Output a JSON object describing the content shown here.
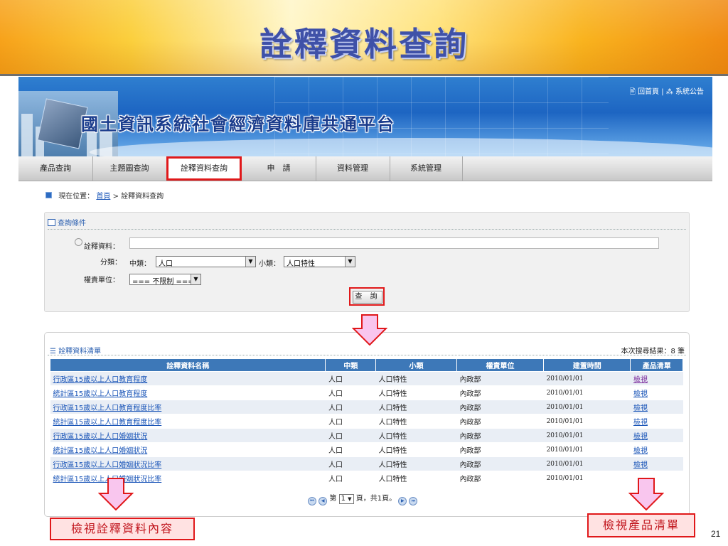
{
  "slide": {
    "title": "詮釋資料查詢",
    "page_number": "21"
  },
  "banner": {
    "site_name": "國土資訊系統社會經濟資料庫共通平台",
    "home_link": "回首頁",
    "separator": "|",
    "announce_link": "系統公告"
  },
  "nav": {
    "items": [
      {
        "label": "產品查詢"
      },
      {
        "label": "主題圖查詢"
      },
      {
        "label": "詮釋資料查詢"
      },
      {
        "label": "申　請"
      },
      {
        "label": "資料管理"
      },
      {
        "label": "系統管理"
      }
    ]
  },
  "breadcrumb": {
    "prefix": "現在位置：",
    "home": "首頁",
    "sep": " > ",
    "current": "詮釋資料查詢"
  },
  "query": {
    "header": "查詢條件",
    "metadata_label": "詮釋資料：",
    "metadata_value": "",
    "category_label": "分類：",
    "major_label": "中類：",
    "major_value": "人口",
    "minor_label": "小類：",
    "minor_value": "人口特性",
    "unit_label": "權責單位：",
    "unit_value": "=== 不限制 ===",
    "submit_label": "查 詢"
  },
  "results": {
    "header": "詮釋資料清單",
    "count_text": "本次搜尋結果：8 筆",
    "columns": [
      "詮釋資料名稱",
      "中類",
      "小類",
      "權責單位",
      "建置時間",
      "產品清單"
    ],
    "rows": [
      {
        "name": "行政區15歲以上人口教育程度",
        "major": "人口",
        "minor": "人口特性",
        "unit": "內政部",
        "date": "2010/01/01",
        "view": "檢視"
      },
      {
        "name": "統計區15歲以上人口教育程度",
        "major": "人口",
        "minor": "人口特性",
        "unit": "內政部",
        "date": "2010/01/01",
        "view": "檢視"
      },
      {
        "name": "行政區15歲以上人口教育程度比率",
        "major": "人口",
        "minor": "人口特性",
        "unit": "內政部",
        "date": "2010/01/01",
        "view": "檢視"
      },
      {
        "name": "統計區15歲以上人口教育程度比率",
        "major": "人口",
        "minor": "人口特性",
        "unit": "內政部",
        "date": "2010/01/01",
        "view": "檢視"
      },
      {
        "name": "行政區15歲以上人口婚姻狀況",
        "major": "人口",
        "minor": "人口特性",
        "unit": "內政部",
        "date": "2010/01/01",
        "view": "檢視"
      },
      {
        "name": "統計區15歲以上人口婚姻狀況",
        "major": "人口",
        "minor": "人口特性",
        "unit": "內政部",
        "date": "2010/01/01",
        "view": "檢視"
      },
      {
        "name": "行政區15歲以上人口婚姻狀況比率",
        "major": "人口",
        "minor": "人口特性",
        "unit": "內政部",
        "date": "2010/01/01",
        "view": "檢視"
      },
      {
        "name": "統計區15歲以上人口婚姻狀況比率",
        "major": "人口",
        "minor": "人口特性",
        "unit": "內政部",
        "date": "2010/01/01",
        "view": ""
      }
    ],
    "pager": {
      "prefix": "第",
      "page": "1",
      "suffix": "頁，共1頁。"
    }
  },
  "annotations": {
    "left_callout": "檢視詮釋資料內容",
    "right_callout": "檢視產品清單"
  },
  "colors": {
    "highlight_red": "#e0181a",
    "table_header_blue": "#3d78b8",
    "arrow_pink": "#f9c6ee"
  }
}
